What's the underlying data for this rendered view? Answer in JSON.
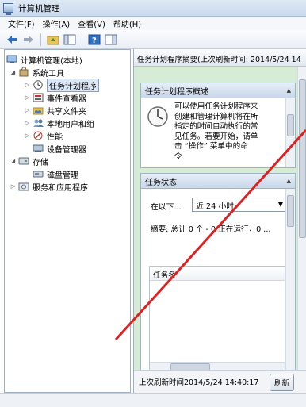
{
  "window": {
    "title": "计算机管理"
  },
  "menu": [
    "文件(F)",
    "操作(A)",
    "查看(V)",
    "帮助(H)"
  ],
  "tree": {
    "root": "计算机管理(本地)",
    "system_tools": "系统工具",
    "task_scheduler": "任务计划程序",
    "event_viewer": "事件查看器",
    "shared_folders": "共享文件夹",
    "local_users": "本地用户和组",
    "performance": "性能",
    "device_manager": "设备管理器",
    "storage": "存储",
    "disk_management": "磁盘管理",
    "services": "服务和应用程序"
  },
  "right": {
    "header": "任务计划程序摘要(上次刷新时间: 2014/5/24 14",
    "overview": {
      "title": "任务计划程序概述",
      "text_lines": [
        "可以使用任务计划程序来",
        "创建和管理计算机将在所",
        "指定的时间自动执行的常",
        "见任务。若要开始，请单",
        "击 “操作” 菜单中的命",
        "令"
      ]
    },
    "status": {
      "title": "任务状态",
      "label": "在以下...",
      "selected": "近 24 小时",
      "summary": "摘要: 总计 0 个 - 0 正在运行，0 ...",
      "table_header": "任务名"
    },
    "footer": {
      "last_refresh": "上次刷新时间2014/5/24 14:40:17",
      "refresh_button": "刷新"
    }
  },
  "colors": {
    "accent_green": "#d7ecd7",
    "annotation_red": "#e02020",
    "selection": "#dce8f7"
  }
}
